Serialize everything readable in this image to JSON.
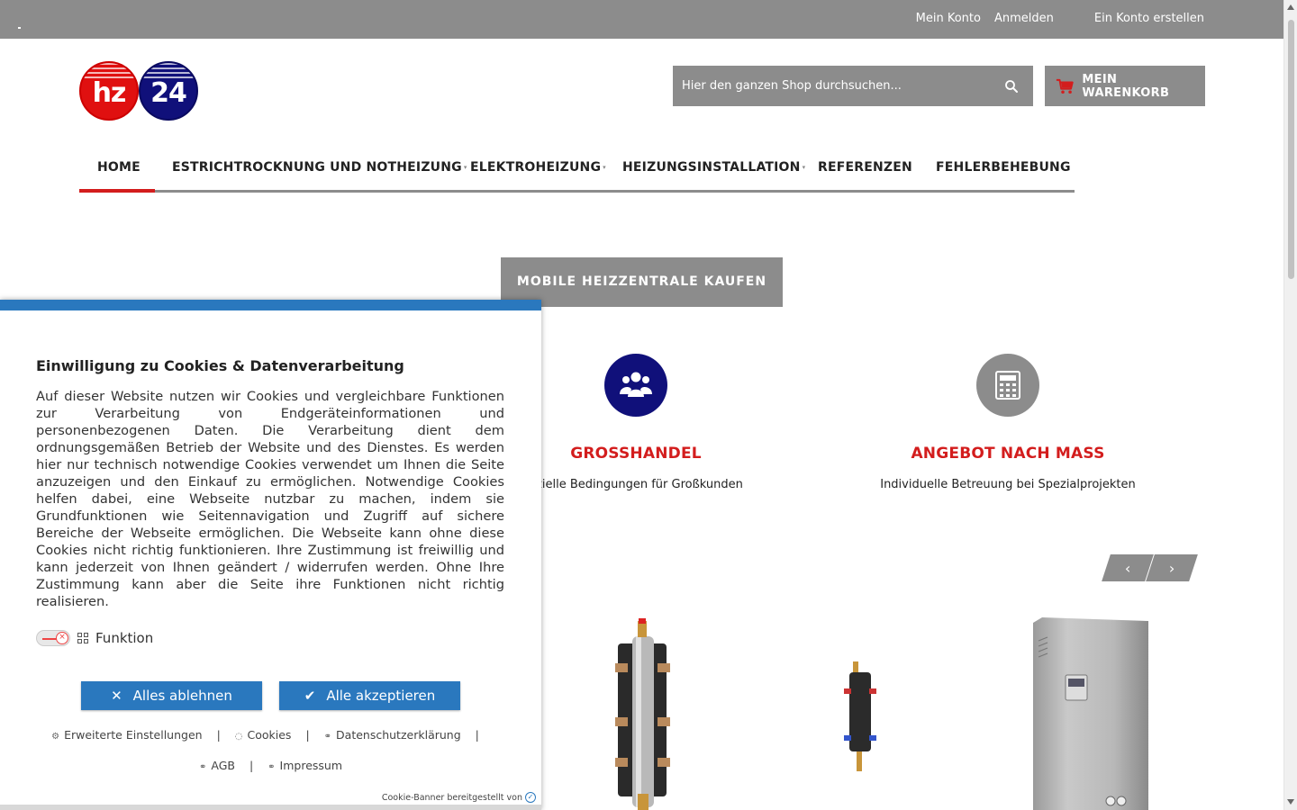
{
  "topbar": {
    "account": "Mein Konto",
    "login": "Anmelden",
    "register": "Ein Konto erstellen"
  },
  "logo": {
    "left": "hz",
    "right": "24"
  },
  "search": {
    "placeholder": "Hier den ganzen Shop durchsuchen..."
  },
  "cart": {
    "label": "MEIN WARENKORB"
  },
  "nav": {
    "items": [
      {
        "label": "HOME"
      },
      {
        "label": "ESTRICHTROCKNUNG UND NOTHEIZUNG"
      },
      {
        "label": "ELEKTROHEIZUNG"
      },
      {
        "label": "HEIZUNGSINSTALLATION"
      },
      {
        "label": "REFERENZEN"
      },
      {
        "label": "FEHLERBEHEBUNG"
      }
    ]
  },
  "cta": {
    "label": "MOBILE HEIZZENTRALE KAUFEN"
  },
  "features": [
    {
      "title": "GROSSHANDEL",
      "subtitle": "ezielle Bedingungen für Großkunden"
    },
    {
      "title": "ANGEBOT NACH MASS",
      "subtitle": "Individuelle Betreuung bei Spezialprojekten"
    }
  ],
  "carousel": {
    "prev": "‹",
    "next": "›"
  },
  "cookie": {
    "title": "Einwilligung zu Cookies & Datenverarbeitung",
    "text": "Auf dieser Website nutzen wir Cookies und vergleichbare Funktionen zur Verarbeitung von Endgeräteinformationen und personenbezogenen Daten. Die Verarbeitung dient dem ordnungsgemäßen Betrieb der Website und des Dienstes. Es werden hier nur technisch notwendige Cookies verwendet um Ihnen die Seite anzuzeigen und den Einkauf zu ermöglichen. Notwendige Cookies helfen dabei, eine Webseite nutzbar zu machen, indem sie Grundfunktionen wie Seitennavigation und Zugriff auf sichere Bereiche der Webseite ermöglichen. Die Webseite kann ohne diese Cookies nicht richtig funktionieren. Ihre Zustimmung ist freiwillig und kann jederzeit von Ihnen geändert / widerrufen werden. Ohne Ihre Zustimmung kann aber die Seite ihre Funktionen nicht richtig realisieren.",
    "toggle_label": "Funktion",
    "reject_label": "Alles ablehnen",
    "accept_label": "Alle akzeptieren",
    "links": {
      "advanced": "Erweiterte Einstellungen",
      "cookies": "Cookies",
      "privacy": "Datenschutzerklärung",
      "agb": "AGB",
      "imprint": "Impressum"
    },
    "separator": "|",
    "footer": "Cookie-Banner bereitgestellt von"
  },
  "colors": {
    "gray": "#8c8c8c",
    "red": "#d31d1d",
    "navy": "#10107a",
    "blue": "#2a78be"
  }
}
